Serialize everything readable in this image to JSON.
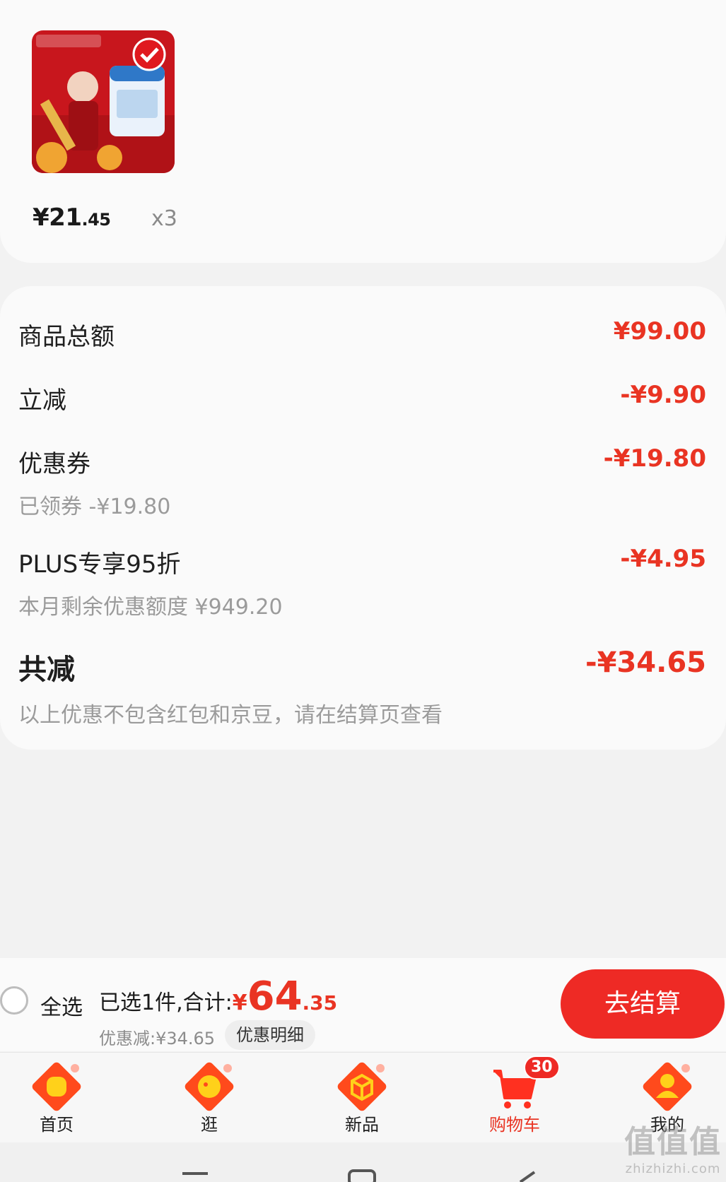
{
  "product": {
    "price_int": "¥21",
    "price_dec": ".45",
    "quantity": "x3"
  },
  "summary": {
    "rows": [
      {
        "label": "商品总额",
        "value": "¥99.00",
        "sub": ""
      },
      {
        "label": "立减",
        "value": "-¥9.90",
        "sub": ""
      },
      {
        "label": "优惠券",
        "value": "-¥19.80",
        "sub": "已领券 -¥19.80"
      },
      {
        "label": "PLUS专享95折",
        "value": "-¥4.95",
        "sub": "本月剩余优惠额度 ¥949.20"
      },
      {
        "label": "共减",
        "value": "-¥34.65",
        "sub": "以上优惠不包含红包和京豆，请在结算页查看"
      }
    ]
  },
  "checkout": {
    "select_all": "全选",
    "selected_text": "已选1件,合计:",
    "currency": "¥",
    "total_int": "64",
    "total_dec": ".35",
    "discount_text": "优惠减:¥34.65",
    "detail_button": "优惠明细",
    "checkout_button": "去结算"
  },
  "tabs": [
    {
      "label": "首页",
      "icon": "home-icon"
    },
    {
      "label": "逛",
      "icon": "discover-icon"
    },
    {
      "label": "新品",
      "icon": "new-products-icon"
    },
    {
      "label": "购物车",
      "icon": "cart-icon",
      "badge": "30",
      "active": true
    },
    {
      "label": "我的",
      "icon": "profile-icon"
    }
  ],
  "watermark": {
    "big": "值值值",
    "small": "zhizhizhi.com"
  },
  "colors": {
    "accent": "#e93423",
    "button": "#ee2a25",
    "tab_icon": "#ff5a1f"
  }
}
